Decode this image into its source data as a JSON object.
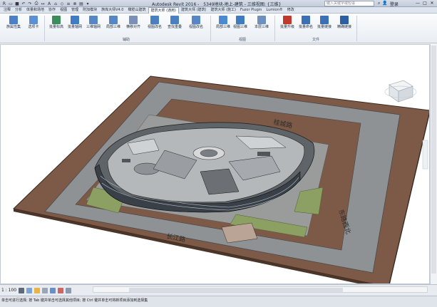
{
  "title_bar": {
    "app": "Autodesk Revit 2016 -",
    "document": "5349地块-地上-建筑 - 三维视图: {三维}",
    "search_placeholder": "键入关键字或短语",
    "login": "登录",
    "qat_icons": [
      "app-menu-icon",
      "open-icon",
      "save-icon",
      "undo-icon",
      "redo-icon",
      "print-icon",
      "measure-icon",
      "text-icon",
      "3d-view-icon",
      "section-icon",
      "thin-lines-icon",
      "close-hidden-icon",
      "switch-windows-icon",
      "dropdown-icon"
    ]
  },
  "tabs": [
    {
      "label": "注释",
      "active": false
    },
    {
      "label": "分析",
      "active": false
    },
    {
      "label": "体量和场地",
      "active": false
    },
    {
      "label": "协作",
      "active": false
    },
    {
      "label": "视图",
      "active": false
    },
    {
      "label": "管理",
      "active": false
    },
    {
      "label": "附加模块",
      "active": false
    },
    {
      "label": "族库大师V4.0",
      "active": false
    },
    {
      "label": "橄榄山建筑",
      "active": false
    },
    {
      "label": "建筑大师 (通用)",
      "active": true
    },
    {
      "label": "建筑大师 (建筑)",
      "active": false
    },
    {
      "label": "建筑大师 (施工)",
      "active": false
    },
    {
      "label": "Fuzor Plugin",
      "active": false
    },
    {
      "label": "Lumion®",
      "active": false
    },
    {
      "label": "修改",
      "active": false
    }
  ],
  "ribbon": {
    "buttons": [
      {
        "label": "族属性集",
        "color": "#4b7fc7"
      },
      {
        "label": "选项卡",
        "color": "#5b8fd6"
      },
      {
        "label": "批量标高",
        "color": "#3c8c5c"
      },
      {
        "label": "批量轴网",
        "color": "#3f7cc4"
      },
      {
        "label": "三维轴网",
        "color": "#5786c6"
      },
      {
        "label": "局部三维",
        "color": "#5786c6"
      },
      {
        "label": "横移对齐",
        "color": "#7a90b8"
      },
      {
        "label": "视图改名",
        "color": "#4a7fc0"
      },
      {
        "label": "查找重叠",
        "color": "#4a7fc0"
      },
      {
        "label": "视图改名",
        "color": "#5786c6"
      },
      {
        "label": "局部三维",
        "color": "#4b8ad0"
      },
      {
        "label": "视图三维",
        "color": "#3d7cc0"
      },
      {
        "label": "本层三维",
        "color": "#6f8fbf"
      },
      {
        "label": "批量升级",
        "color": "#c0392b"
      },
      {
        "label": "批量命名",
        "color": "#3b6fb6"
      },
      {
        "label": "批量链接",
        "color": "#3b6fb6"
      },
      {
        "label": "精确链接",
        "color": "#2b5fa3"
      }
    ],
    "panels": [
      "辅助",
      "视图",
      "文件"
    ]
  },
  "drawing": {
    "road_labels": [
      "桂城路",
      "东路西北",
      "长江路"
    ]
  },
  "view_bar": {
    "scale": "1 : 100"
  },
  "status_bar": {
    "text": "单击可进行选择; 按 Tab 键并单击可选择其他项目; 按 Ctrl 键并单击可将新项目添加到选择集"
  }
}
